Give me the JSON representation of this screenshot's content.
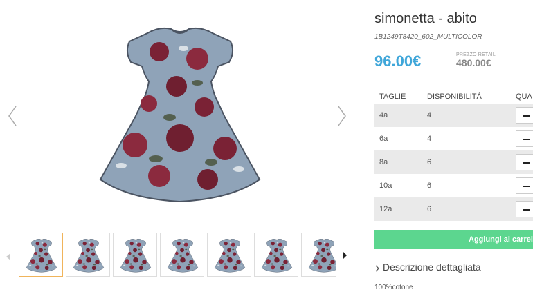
{
  "product": {
    "title": "simonetta - abito",
    "sku": "1B1249T8420_602_MULTICOLOR",
    "price": "96.00€",
    "retail_label": "PREZZO RETAIL",
    "retail_price": "480.00€"
  },
  "sizes_table": {
    "headers": {
      "size": "TAGLIE",
      "availability": "DISPONIBILITÀ",
      "quantity": "QUA"
    },
    "rows": [
      {
        "size": "4a",
        "availability": "4"
      },
      {
        "size": "6a",
        "availability": "4"
      },
      {
        "size": "8a",
        "availability": "6"
      },
      {
        "size": "10a",
        "availability": "6"
      },
      {
        "size": "12a",
        "availability": "6"
      }
    ]
  },
  "actions": {
    "add_to_cart": "Aggiungi al carrello"
  },
  "description": {
    "heading": "Descrizione dettagliata",
    "text": "100%cotone"
  },
  "gallery": {
    "thumbnail_count": 7,
    "active_thumbnail": 1
  },
  "colors": {
    "price": "#3fa6d9",
    "add_to_cart": "#5cd68f",
    "active_thumb_border": "#f0b45b"
  },
  "icons": {
    "prev": "chevron-left-icon",
    "next": "chevron-right-icon",
    "thumb_prev": "triangle-left-icon",
    "thumb_next": "triangle-right-icon",
    "description": "chevron-right-icon",
    "quantity_decrease": "minus-icon"
  }
}
